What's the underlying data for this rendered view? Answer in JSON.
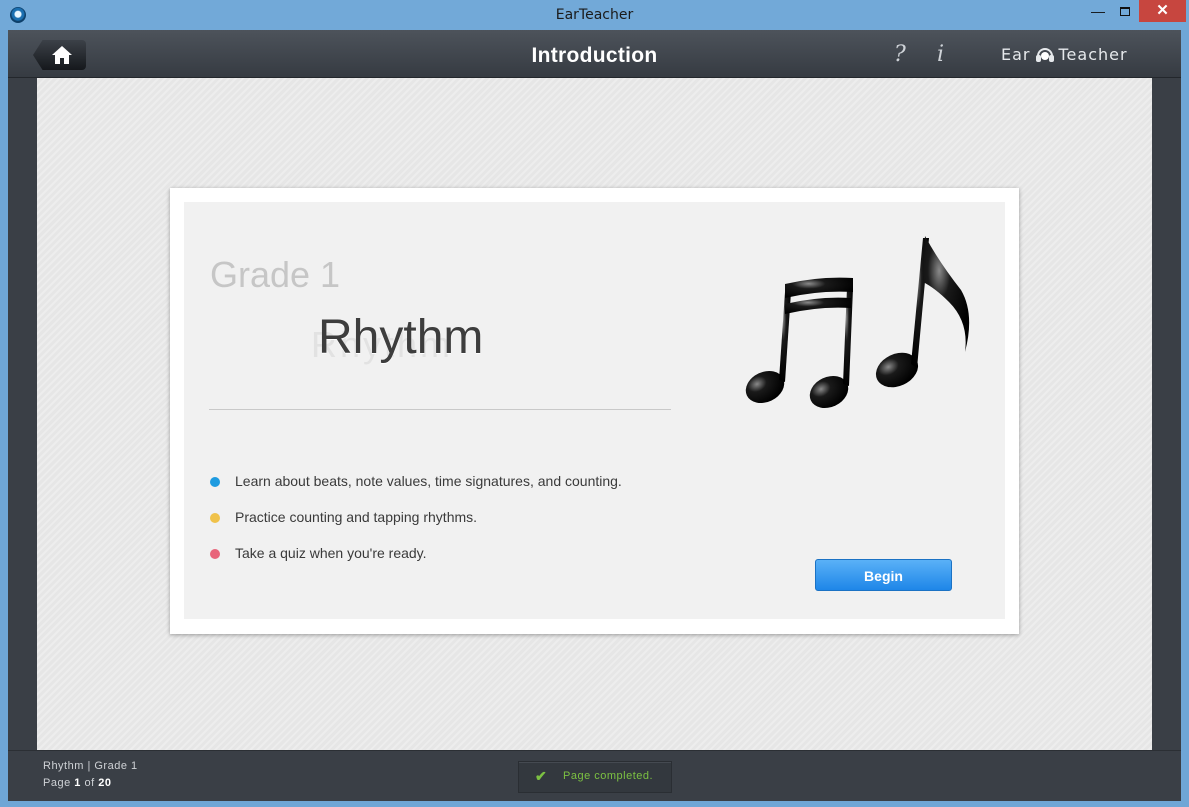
{
  "window": {
    "title": "EarTeacher",
    "controls": {
      "minimize": "—",
      "close": "✕"
    }
  },
  "header": {
    "title": "Introduction",
    "help_label": "?",
    "info_label": "i",
    "logo_left": "Ear",
    "logo_right": "Teacher"
  },
  "lesson": {
    "grade": "Grade 1",
    "subject": "Rhythm",
    "bullets": [
      {
        "text": "Learn about beats, note values, time signatures, and counting.",
        "color": "#1e9be0"
      },
      {
        "text": "Practice counting and tapping rhythms.",
        "color": "#f0c24a"
      },
      {
        "text": "Take a quiz when you're ready.",
        "color": "#e8647a"
      }
    ],
    "begin_label": "Begin"
  },
  "footer": {
    "breadcrumb": "Rhythm | Grade 1",
    "page_prefix": "Page",
    "page_current": "1",
    "page_of": "of",
    "page_total": "20",
    "status_text": "Page completed.",
    "status_color": "#7cc142"
  }
}
